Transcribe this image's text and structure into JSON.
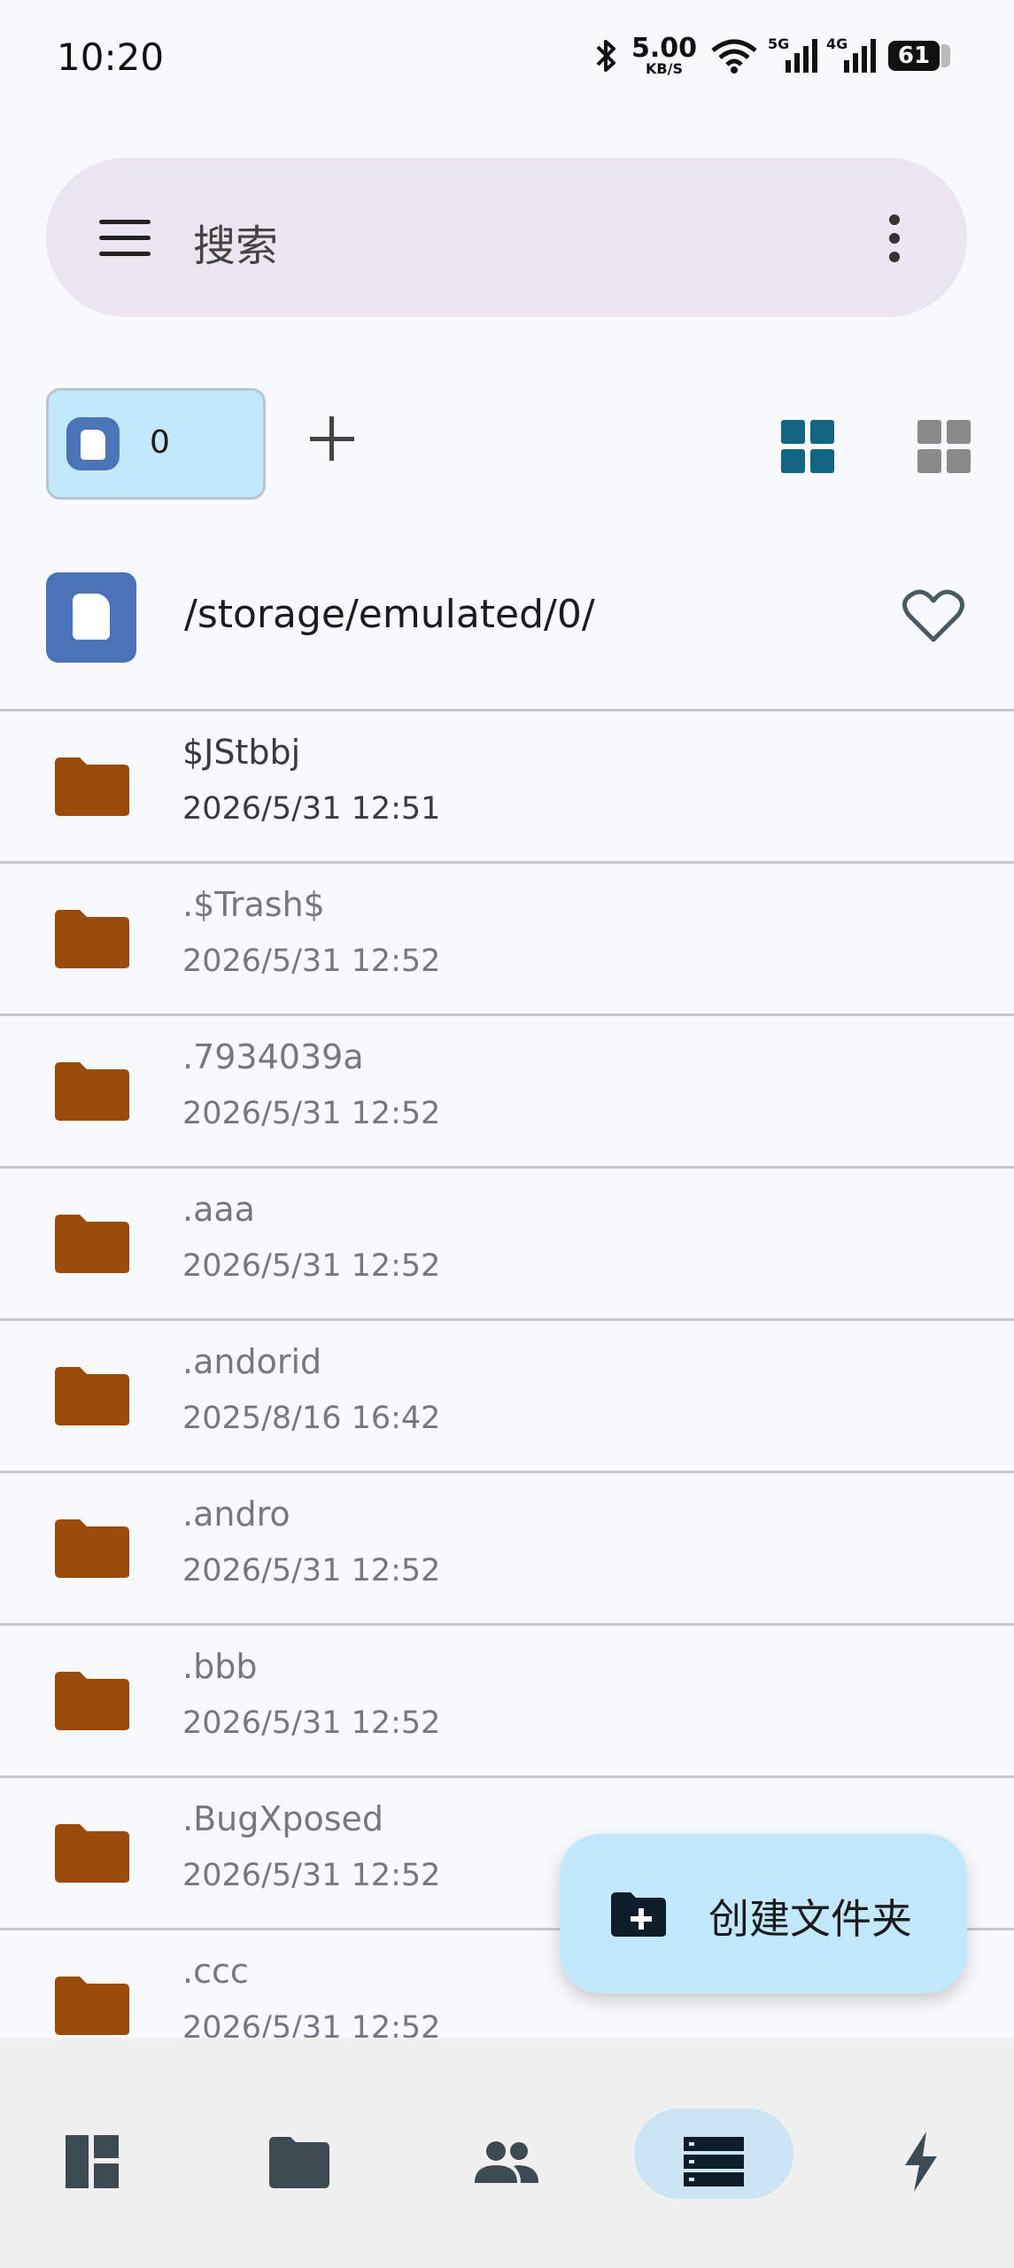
{
  "status_bar": {
    "time": "10:20",
    "net_speed_value": "5.00",
    "net_speed_unit": "KB/S",
    "sim1_tag": "5G",
    "sim2_tag": "4G",
    "battery_level": "61",
    "icons": [
      "bluetooth-icon",
      "wifi-icon",
      "signal-5g-icon",
      "signal-4g-icon",
      "battery-icon"
    ]
  },
  "search": {
    "placeholder": "搜索",
    "icons": [
      "menu-icon",
      "more-vert-icon"
    ]
  },
  "storage": {
    "chip_count": "0",
    "icons": [
      "sd-card-icon",
      "add-icon",
      "grid-view-icon"
    ]
  },
  "path": {
    "current": "/storage/emulated/0/"
  },
  "files": [
    {
      "name": "$JStbbj",
      "date": "2026/5/31 12:51"
    },
    {
      "name": ".$Trash$",
      "date": "2026/5/31 12:52"
    },
    {
      "name": ".7934039a",
      "date": "2026/5/31 12:52"
    },
    {
      "name": ".aaa",
      "date": "2026/5/31 12:52"
    },
    {
      "name": ".andorid",
      "date": "2025/8/16 16:42"
    },
    {
      "name": ".andro",
      "date": "2026/5/31 12:52"
    },
    {
      "name": ".bbb",
      "date": "2026/5/31 12:52"
    },
    {
      "name": ".BugXposed",
      "date": "2026/5/31 12:52"
    },
    {
      "name": ".ccc",
      "date": "2026/5/31 12:52"
    }
  ],
  "fab": {
    "label": "创建文件夹"
  },
  "bottom_nav": {
    "items": [
      "dashboard-icon",
      "folder-icon",
      "people-icon",
      "storage-list-icon",
      "bolt-icon"
    ],
    "active_index": 3
  },
  "colors": {
    "accent": "#126683",
    "chip_bg": "#c2e8fb",
    "folder": "#9a4b0c",
    "sd_blue": "#4a73b8"
  }
}
